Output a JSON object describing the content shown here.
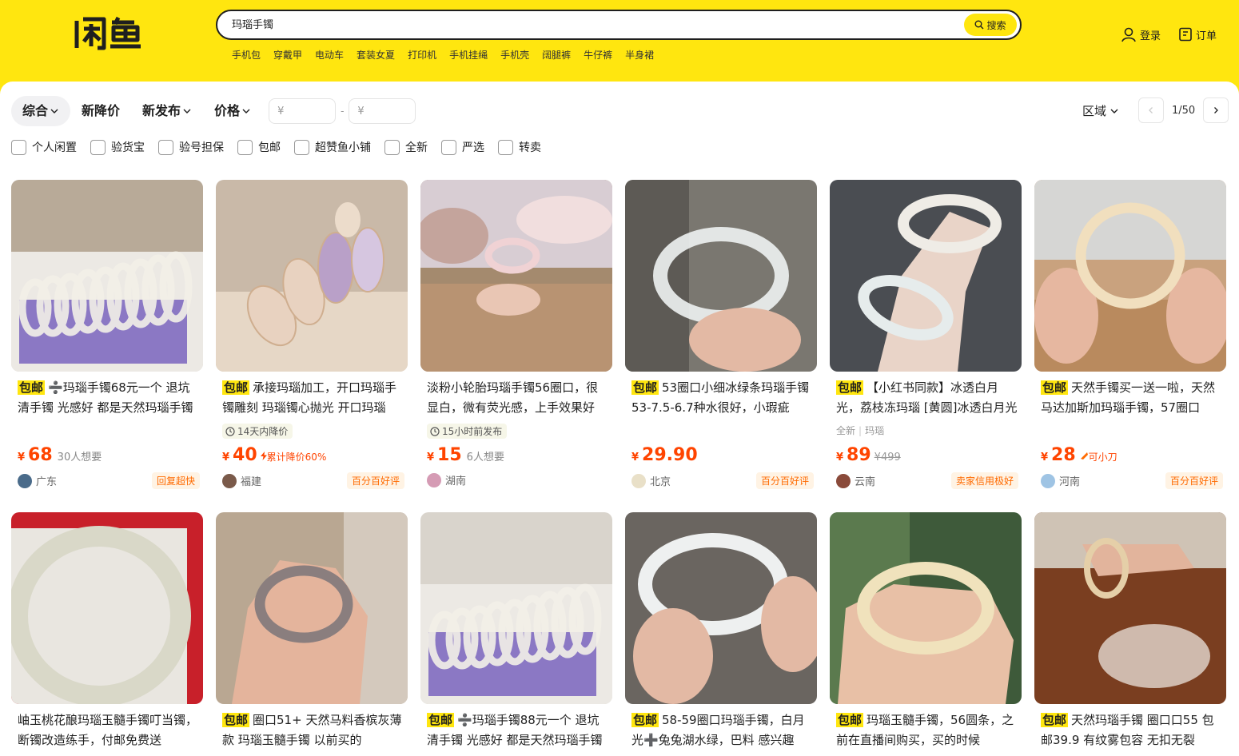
{
  "header": {
    "logo_text": "闲鱼",
    "search_value": "玛瑙手镯",
    "search_button": "搜索",
    "hot_words": [
      "手机包",
      "穿戴甲",
      "电动车",
      "套装女夏",
      "打印机",
      "手机挂绳",
      "手机壳",
      "阔腿裤",
      "牛仔裤",
      "半身裙"
    ],
    "login": "登录",
    "orders": "订单"
  },
  "filters": {
    "sort": [
      "综合",
      "新降价",
      "新发布",
      "价格"
    ],
    "price_min": "¥",
    "price_max": "¥",
    "price_dash": "-",
    "region": "区域",
    "page": "1/50",
    "checkboxes": [
      "个人闲置",
      "验货宝",
      "验号担保",
      "包邮",
      "超赞鱼小铺",
      "全新",
      "严选",
      "转卖"
    ]
  },
  "items": [
    {
      "free": "包邮",
      "title": "➗玛瑙手镯68元一个 退坑清手镯 光感好 都是天然玛瑙手镯",
      "price_int": "68",
      "extra": "30人想要",
      "location": "广东",
      "badge": "回复超快"
    },
    {
      "free": "包邮",
      "title": "承接玛瑙加工，开口玛瑙手镯雕刻 玛瑙镯心抛光 开口玛瑙",
      "sub": "14天内降价",
      "price_int": "40",
      "drop": "累计降价60%",
      "location": "福建",
      "badge": "百分百好评"
    },
    {
      "free": "",
      "title": "淡粉小轮胎玛瑙手镯56圈口，很显白，微有荧光感，上手效果好",
      "sub": "15小时前发布",
      "price_int": "15",
      "extra": "6人想要",
      "location": "湖南",
      "badge": ""
    },
    {
      "free": "包邮",
      "title": "53圈口小细冰绿条玛瑙手镯 53-7.5-6.7种水很好，小瑕疵",
      "price_int": "29.90",
      "location": "北京",
      "badge": "百分百好评"
    },
    {
      "free": "包邮",
      "title": "【小红书同款】冰透白月光，荔枝冻玛瑙 [黄圆]冰透白月光",
      "tags": [
        "全新",
        "玛瑙"
      ],
      "price_int": "89",
      "strike": "¥499",
      "location": "云南",
      "badge": "卖家信用极好"
    },
    {
      "free": "包邮",
      "title": "天然手镯买一送一啦，天然马达加斯加玛瑙手镯，57圈口",
      "price_int": "28",
      "knife": "可小刀",
      "location": "河南",
      "badge": "百分百好评"
    },
    {
      "free": "",
      "title": "岫玉桃花酿玛瑙玉髓手镯叮当镯，断镯改造练手，付邮免费送",
      "price_int": "",
      "location": "",
      "badge": ""
    },
    {
      "free": "包邮",
      "title": "圈口51+ 天然马料香槟灰薄款 玛瑙玉髓手镯 以前买的",
      "price_int": "",
      "location": "",
      "badge": ""
    },
    {
      "free": "包邮",
      "title": "➗玛瑙手镯88元一个 退坑清手镯 光感好 都是天然玛瑙手镯",
      "price_int": "",
      "location": "",
      "badge": ""
    },
    {
      "free": "包邮",
      "title": "58-59圈口玛瑙手镯，白月光➕兔兔湖水绿，巴料 感兴趣",
      "price_int": "",
      "location": "",
      "badge": ""
    },
    {
      "free": "包邮",
      "title": "玛瑙玉髓手镯，56圆条，之前在直播间购买，买的时候",
      "price_int": "",
      "location": "",
      "badge": ""
    },
    {
      "free": "包邮",
      "title": "天然玛瑙手镯 圈口口55 包邮39.9 有纹雾包容 无扣无裂",
      "price_int": "",
      "location": "",
      "badge": ""
    }
  ],
  "colors": {
    "brand": "#ffe60f",
    "price": "#ff4400"
  }
}
